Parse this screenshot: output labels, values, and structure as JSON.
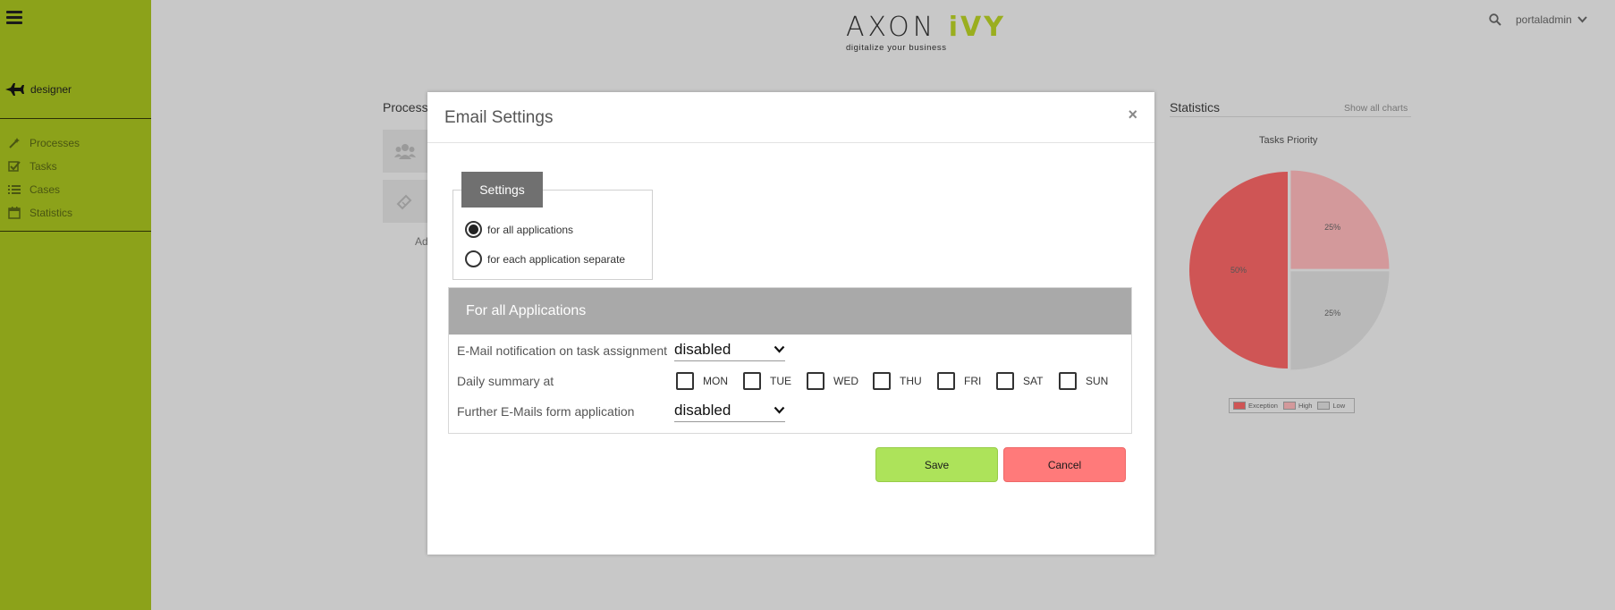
{
  "sidebar": {
    "user": "designer",
    "items": [
      {
        "label": "Processes",
        "icon": "wand-icon"
      },
      {
        "label": "Tasks",
        "icon": "checkbox-icon"
      },
      {
        "label": "Cases",
        "icon": "list-icon"
      },
      {
        "label": "Statistics",
        "icon": "calendar-icon"
      }
    ]
  },
  "header": {
    "logo_main": "AXON",
    "logo_accent": "iVY",
    "logo_tagline": "digitalize your business",
    "username": "portaladmin"
  },
  "background": {
    "process_title": "Process",
    "process_tile_label": "Ad",
    "statistics_title": "Statistics",
    "statistics_link": "Show all charts",
    "chart_title": "Tasks Priority"
  },
  "chart_data": {
    "type": "pie",
    "title": "Tasks Priority",
    "categories": [
      "Exception",
      "High",
      "Low"
    ],
    "values": [
      50,
      25,
      25
    ],
    "labels": [
      "50%",
      "25%",
      "25%"
    ],
    "colors": [
      "#cf5555",
      "#d3999b",
      "#b9b9b9"
    ],
    "legend": "bottom"
  },
  "modal": {
    "title": "Email Settings",
    "close": "×",
    "settings_legend": "Settings",
    "radio_all": "for all applications",
    "radio_each": "for each application separate",
    "panel_title": "For all Applications",
    "notification_label": "E-Mail notification on task assignment",
    "notification_value": "disabled",
    "daily_label": "Daily summary at",
    "days": [
      "MON",
      "TUE",
      "WED",
      "THU",
      "FRI",
      "SAT",
      "SUN"
    ],
    "further_label": "Further E-Mails form application",
    "further_value": "disabled",
    "save": "Save",
    "cancel": "Cancel"
  }
}
